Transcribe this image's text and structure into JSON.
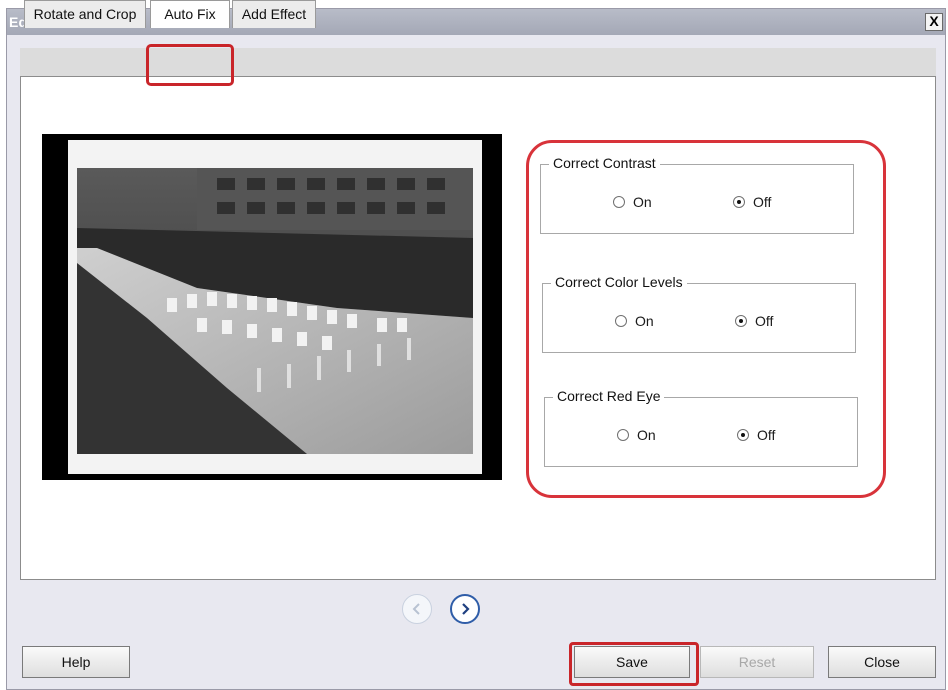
{
  "window": {
    "title": "Edit Pictures",
    "close_label": "X"
  },
  "tabs": [
    {
      "label": "Rotate and Crop",
      "active": false
    },
    {
      "label": "Auto Fix",
      "active": true
    },
    {
      "label": "Add Effect",
      "active": false
    }
  ],
  "options": [
    {
      "title": "Correct Contrast",
      "on_label": "On",
      "off_label": "Off",
      "selected": "Off"
    },
    {
      "title": "Correct Color Levels",
      "on_label": "On",
      "off_label": "Off",
      "selected": "Off"
    },
    {
      "title": "Correct Red Eye",
      "on_label": "On",
      "off_label": "Off",
      "selected": "Off"
    }
  ],
  "navigation": {
    "prev_enabled": false,
    "next_enabled": true
  },
  "buttons": {
    "help": "Help",
    "save": "Save",
    "reset": "Reset",
    "close": "Close"
  },
  "colors": {
    "highlight": "#c9252a",
    "nav_accent": "#2f5da8"
  }
}
